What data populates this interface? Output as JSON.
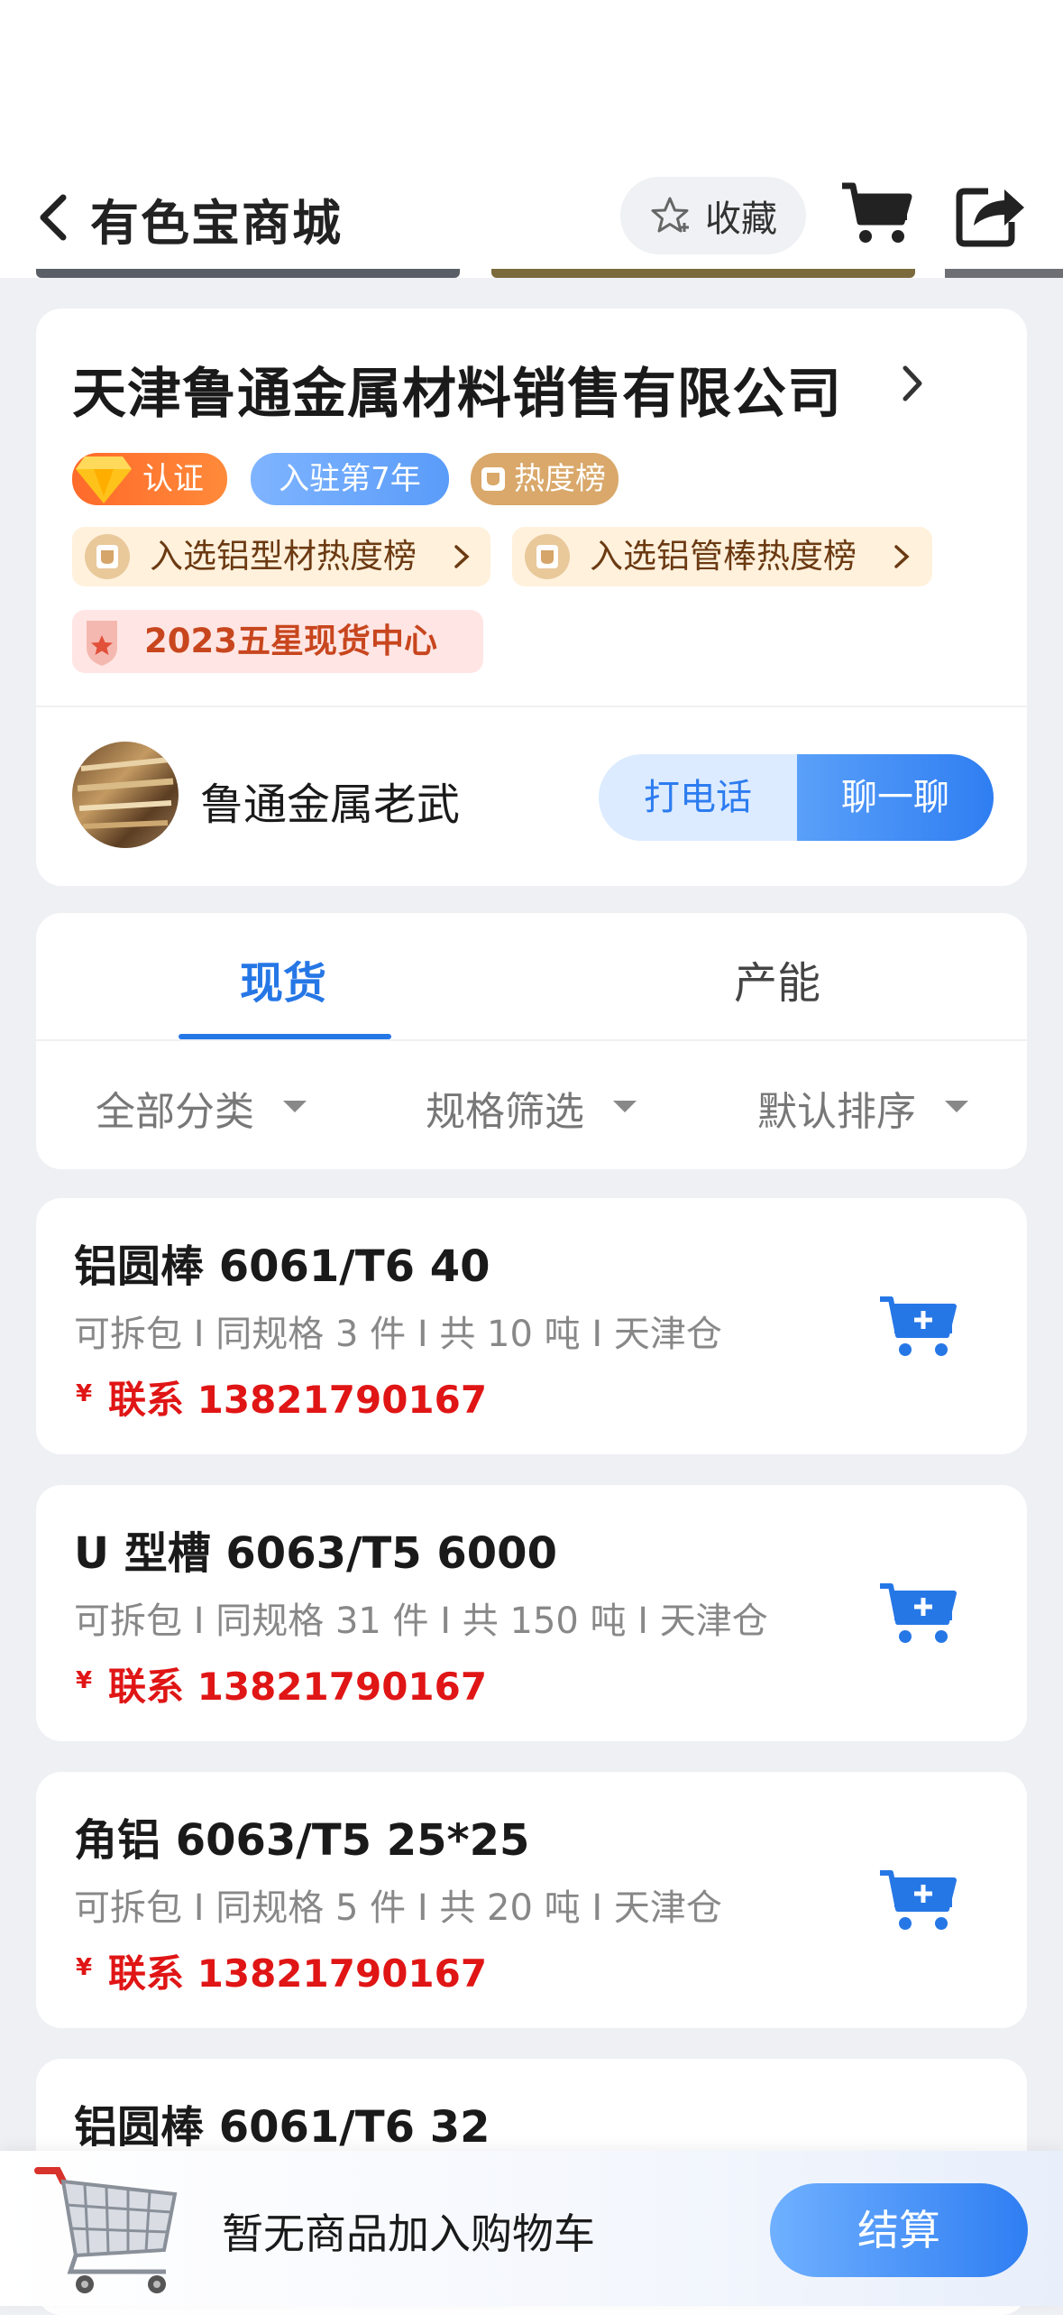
{
  "nav": {
    "title": "有色宝商城",
    "favorite_label": "收藏"
  },
  "shop": {
    "name": "天津鲁通金属材料销售有限公司",
    "badges": {
      "verified": "认证",
      "years": "入驻第7年",
      "hot": "热度榜"
    },
    "rankings": [
      "入选铝型材热度榜",
      "入选铝管棒热度榜"
    ],
    "honor": "2023五星现货中心",
    "contact_name": "鲁通金属老武",
    "call_label": "打电话",
    "chat_label": "聊一聊"
  },
  "tabs": {
    "stock": "现货",
    "capacity": "产能"
  },
  "filters": {
    "category": "全部分类",
    "spec": "规格筛选",
    "sort": "默认排序"
  },
  "products": [
    {
      "title": "铝圆棒 6061/T6 40",
      "spec": "可拆包 I 同规格 3 件 I 共 10 吨 I 天津仓",
      "currency": "¥",
      "price": "联系 13821790167"
    },
    {
      "title": "U 型槽 6063/T5 6000",
      "spec": "可拆包 I 同规格 31 件 I 共 150 吨 I 天津仓",
      "currency": "¥",
      "price": "联系 13821790167"
    },
    {
      "title": "角铝 6063/T5 25*25",
      "spec": "可拆包 I 同规格 5 件 I 共 20 吨 I 天津仓",
      "currency": "¥",
      "price": "联系 13821790167"
    },
    {
      "title": "铝圆棒 6061/T6 32"
    }
  ],
  "cart_bar": {
    "empty_text": "暂无商品加入购物车",
    "checkout_label": "结算"
  },
  "colors": {
    "accent_blue": "#2677e6",
    "price_red": "#e01515",
    "background": "#eff0f4"
  }
}
